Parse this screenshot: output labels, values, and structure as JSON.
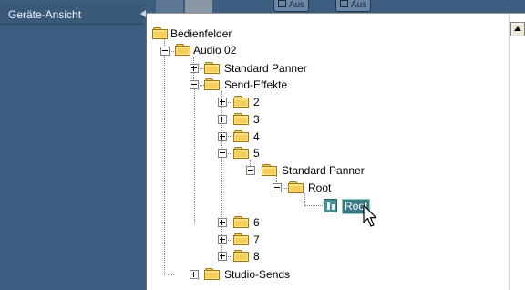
{
  "left_panel": {
    "item_label": "Geräte-Ansicht"
  },
  "top_toolbar": {
    "button1": "Aus",
    "button2": "Aus"
  },
  "tree": {
    "root": "Bedienfelder",
    "audio": "Audio 02",
    "panner": "Standard Panner",
    "send_effects": "Send-Effekte",
    "send2": "2",
    "send3": "3",
    "send4": "4",
    "send5": "5",
    "send5_panner": "Standard Panner",
    "send5_root": "Root",
    "send5_root_param": "Root",
    "send6": "6",
    "send7": "7",
    "send8": "8",
    "studio_sends": "Studio-Sends"
  },
  "colors": {
    "panel_bg": "#3e5e80",
    "selection_bg": "#3a7a86",
    "folder": "#fbe28a"
  }
}
